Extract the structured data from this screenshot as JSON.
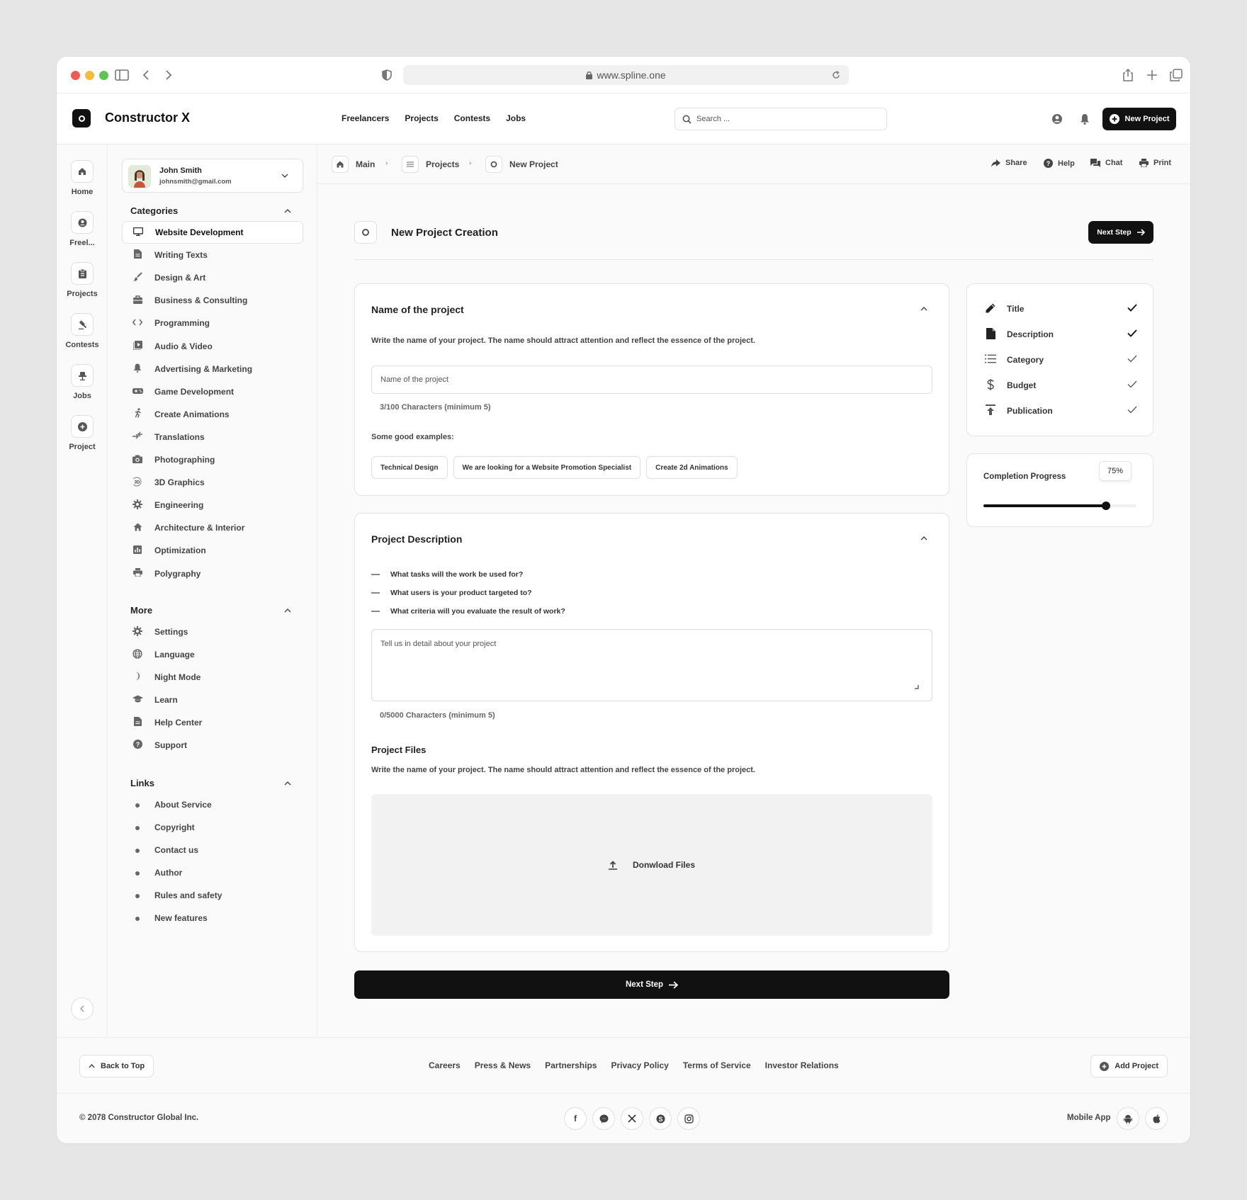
{
  "browser": {
    "url": "www.spline.one"
  },
  "header": {
    "brand": "Constructor X",
    "nav": [
      "Freelancers",
      "Projects",
      "Contests",
      "Jobs"
    ],
    "search_placeholder": "Search ...",
    "new_project": "New Project"
  },
  "rail": {
    "items": [
      "Home",
      "Freel...",
      "Projects",
      "Contests",
      "Jobs",
      "Project"
    ]
  },
  "sidebar": {
    "user": {
      "name": "John Smith",
      "email": "johnsmith@gmail.com"
    },
    "categories_title": "Categories",
    "categories": [
      {
        "label": "Website Development",
        "icon": "monitor-icon"
      },
      {
        "label": "Writing Texts",
        "icon": "document-icon"
      },
      {
        "label": "Design & Art",
        "icon": "brush-icon"
      },
      {
        "label": "Business & Consulting",
        "icon": "briefcase-icon"
      },
      {
        "label": "Programming",
        "icon": "code-icon"
      },
      {
        "label": "Audio & Video",
        "icon": "play-icon"
      },
      {
        "label": "Advertising & Marketing",
        "icon": "bell-icon"
      },
      {
        "label": "Game Development",
        "icon": "gamepad-icon"
      },
      {
        "label": "Create Animations",
        "icon": "running-icon"
      },
      {
        "label": "Translations",
        "icon": "translate-icon"
      },
      {
        "label": "Photographing",
        "icon": "camera-icon"
      },
      {
        "label": "3D Graphics",
        "icon": "3d-icon"
      },
      {
        "label": "Engineering",
        "icon": "gear-icon"
      },
      {
        "label": "Architecture & Interior",
        "icon": "house-icon"
      },
      {
        "label": "Optimization",
        "icon": "chart-icon"
      },
      {
        "label": "Polygraphy",
        "icon": "printer-icon"
      }
    ],
    "more_title": "More",
    "more": [
      {
        "label": "Settings",
        "icon": "gear-icon"
      },
      {
        "label": "Language",
        "icon": "globe-icon"
      },
      {
        "label": "Night Mode",
        "icon": "moon-icon"
      },
      {
        "label": "Learn",
        "icon": "graduation-icon"
      },
      {
        "label": "Help Center",
        "icon": "document-icon"
      },
      {
        "label": "Support",
        "icon": "question-icon"
      }
    ],
    "links_title": "Links",
    "links": [
      "About Service",
      "Copyright",
      "Contact us",
      "Author",
      "Rules and safety",
      "New features"
    ]
  },
  "breadcrumb": {
    "items": [
      "Main",
      "Projects",
      "New Project"
    ],
    "actions": [
      "Share",
      "Help",
      "Chat",
      "Print"
    ]
  },
  "page": {
    "title": "New Project Creation",
    "next_step": "Next Step"
  },
  "name_card": {
    "title": "Name of the project",
    "desc": "Write the name of your project. The name should attract attention and reflect the essence of the project.",
    "input_value": "Name of the project",
    "counter": "3/100 Characters (minimum 5)",
    "examples_label": "Some good examples:",
    "examples": [
      "Technical Design",
      "We are looking for a Website Promotion Specialist",
      "Create 2d Animations"
    ]
  },
  "desc_card": {
    "title": "Project Description",
    "questions": [
      "What tasks will the work be used for?",
      "What users is your product targeted to?",
      "What criteria will you evaluate the result of work?"
    ],
    "placeholder": "Tell us in detail about your project",
    "counter": "0/5000 Characters (minimum 5)",
    "files_title": "Project Files",
    "files_desc": "Write the name of your project. The name should attract attention and reflect the essence of the project.",
    "upload_label": "Donwload Files"
  },
  "checklist": [
    {
      "label": "Title",
      "icon": "pencil-icon"
    },
    {
      "label": "Description",
      "icon": "file-icon"
    },
    {
      "label": "Category",
      "icon": "list-icon"
    },
    {
      "label": "Budget",
      "icon": "dollar-icon"
    },
    {
      "label": "Publication",
      "icon": "upload-icon"
    }
  ],
  "progress": {
    "label": "Completion Progress",
    "value_label": "75%",
    "value": 0.8
  },
  "bottom_next": "Next Step",
  "footer": {
    "back_to_top": "Back to Top",
    "links": [
      "Careers",
      "Press & News",
      "Partnerships",
      "Privacy Policy",
      "Terms of Service",
      "Investor Relations"
    ],
    "add_project": "Add Project",
    "copyright": "© 2078 Constructor Global Inc.",
    "social": [
      "facebook-icon",
      "messenger-icon",
      "x-icon",
      "skype-icon",
      "instagram-icon"
    ],
    "mobile_app": "Mobile App"
  }
}
